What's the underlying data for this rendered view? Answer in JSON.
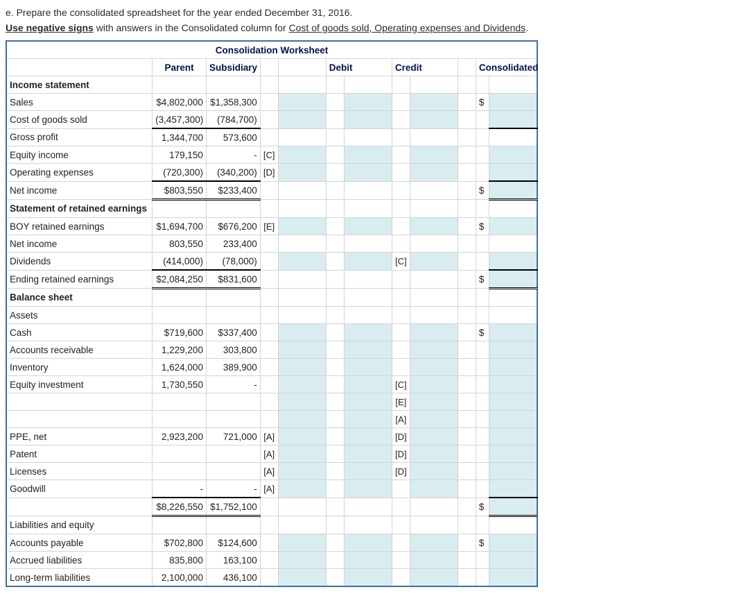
{
  "question": "e. Prepare the consolidated spreadsheet for the year ended December 31, 2016.",
  "instr": {
    "p1": "Use negative signs",
    "p2": " with answers in the Consolidated column for ",
    "p3": "Cost of goods sold, Operating expenses and Dividends",
    "p4": "."
  },
  "title": "Consolidation Worksheet",
  "h": {
    "c1": "Parent",
    "c2": "Subsidiary",
    "c3": "Debit",
    "c4": "Credit",
    "c5": "Consolidated"
  },
  "s1": "Income statement",
  "r": {
    "sales": {
      "l": "Sales",
      "p": "$4,802,000",
      "s": "$1,358,300",
      "con": "$"
    },
    "cogs": {
      "l": "Cost of goods sold",
      "p": "(3,457,300)",
      "s": "(784,700)"
    },
    "gp": {
      "l": "Gross profit",
      "p": "1,344,700",
      "s": "573,600"
    },
    "eqi": {
      "l": "Equity income",
      "p": "179,150",
      "s": "-",
      "d": "[C]"
    },
    "opx": {
      "l": "Operating expenses",
      "p": "(720,300)",
      "s": "(340,200)",
      "d": "[D]"
    },
    "ni": {
      "l": "Net income",
      "p": "$803,550",
      "s": "$233,400",
      "con": "$"
    },
    "s2": "Statement of retained earnings",
    "boy": {
      "l": "BOY retained earnings",
      "p": "$1,694,700",
      "s": "$676,200",
      "d": "[E]",
      "con": "$"
    },
    "ni2": {
      "l": "Net income",
      "p": "803,550",
      "s": "233,400"
    },
    "div": {
      "l": "Dividends",
      "p": "(414,000)",
      "s": "(78,000)",
      "c": "[C]"
    },
    "ere": {
      "l": "Ending retained earnings",
      "p": "$2,084,250",
      "s": "$831,600",
      "con": "$"
    },
    "s3": "Balance sheet",
    "as": "Assets",
    "cash": {
      "l": "Cash",
      "p": "$719,600",
      "s": "$337,400",
      "con": "$"
    },
    "ar": {
      "l": "Accounts receivable",
      "p": "1,229,200",
      "s": "303,800"
    },
    "inv": {
      "l": "Inventory",
      "p": "1,624,000",
      "s": "389,900"
    },
    "einv": {
      "l": "Equity investment",
      "p": "1,730,550",
      "s": "-",
      "c": "[C]"
    },
    "b1": {
      "c": "[E]"
    },
    "b2": {
      "c": "[A]"
    },
    "ppe": {
      "l": "PPE, net",
      "p": "2,923,200",
      "s": "721,000",
      "d": "[A]",
      "c": "[D]"
    },
    "pat": {
      "l": "Patent",
      "d": "[A]",
      "c": "[D]"
    },
    "lic": {
      "l": "Licenses",
      "d": "[A]",
      "c": "[D]"
    },
    "gw": {
      "l": "Goodwill",
      "p": "-",
      "s": "-",
      "d": "[A]"
    },
    "tot": {
      "p": "$8,226,550",
      "s": "$1,752,100",
      "con": "$"
    },
    "le": "Liabilities and equity",
    "ap": {
      "l": "Accounts payable",
      "p": "$702,800",
      "s": "$124,600",
      "con": "$"
    },
    "al": {
      "l": "Accrued liabilities",
      "p": "835,800",
      "s": "163,100"
    },
    "ltl": {
      "l": "Long-term liabilities",
      "p": "2,100,000",
      "s": "436,100"
    }
  }
}
